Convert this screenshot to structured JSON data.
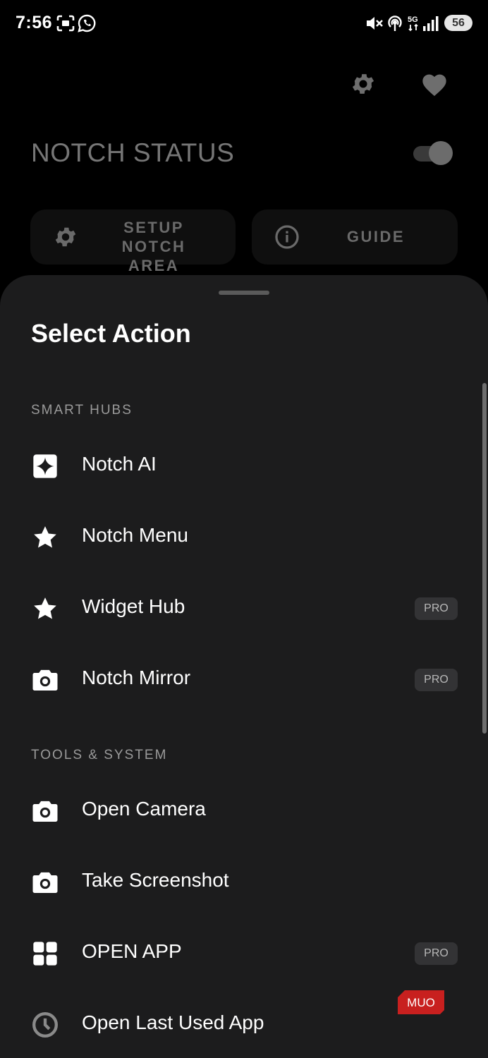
{
  "status_bar": {
    "time": "7:56",
    "battery": "56"
  },
  "app": {
    "status_label": "NOTCH STATUS",
    "setup_button_label_line1": "SETUP NOTCH",
    "setup_button_label_line2": "AREA",
    "guide_button_label": "GUIDE",
    "toggle_on": true
  },
  "sheet": {
    "title": "Select Action",
    "sections": [
      {
        "label": "SMART HUBS",
        "items": [
          {
            "label": "Notch AI",
            "icon": "sparkle-icon",
            "pro": ""
          },
          {
            "label": "Notch Menu",
            "icon": "star-icon",
            "pro": ""
          },
          {
            "label": "Widget Hub",
            "icon": "star-icon",
            "pro": "PRO"
          },
          {
            "label": "Notch Mirror",
            "icon": "camera-icon",
            "pro": "PRO"
          }
        ]
      },
      {
        "label": "TOOLS & SYSTEM",
        "items": [
          {
            "label": "Open Camera",
            "icon": "camera-icon",
            "pro": ""
          },
          {
            "label": "Take Screenshot",
            "icon": "camera-icon",
            "pro": ""
          },
          {
            "label": "OPEN APP",
            "icon": "grid-icon",
            "pro": "PRO"
          },
          {
            "label": "Open Last Used App",
            "icon": "history-icon",
            "pro": ""
          }
        ]
      }
    ]
  },
  "watermark": "MUO",
  "colors": {
    "sheet_bg": "#1c1c1d",
    "pro_badge_bg": "#333335",
    "watermark_red": "#c8201f"
  }
}
